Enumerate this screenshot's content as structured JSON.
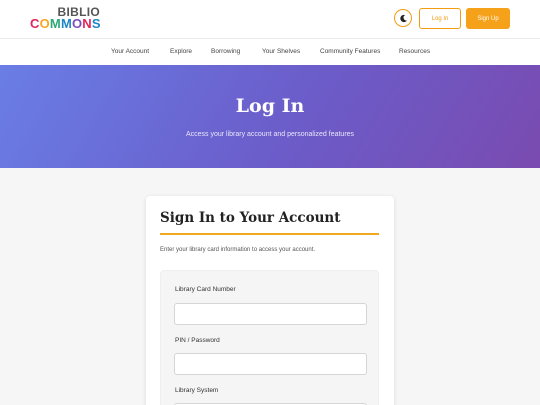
{
  "logo": {
    "line1": "BIBLIO",
    "line2_letters": [
      "C",
      "O",
      "M",
      "M",
      "O",
      "N",
      "S"
    ]
  },
  "header": {
    "theme_icon": "moon-icon",
    "login_label": "Log In",
    "signup_label": "Sign Up",
    "accent_color": "#f5a11a"
  },
  "nav": {
    "items": [
      "Your Account",
      "Explore",
      "Borrowing",
      "Your Shelves",
      "Community Features",
      "Resources"
    ]
  },
  "hero": {
    "title": "Log In",
    "subtitle": "Access your library account and personalized features"
  },
  "card": {
    "title": "Sign In to Your Account",
    "description": "Enter your library card information to access your account.",
    "fields": [
      {
        "label": "Library Card Number",
        "value": "",
        "placeholder": ""
      },
      {
        "label": "PIN / Password",
        "value": "",
        "placeholder": ""
      },
      {
        "label": "Library System",
        "value": ""
      }
    ]
  }
}
